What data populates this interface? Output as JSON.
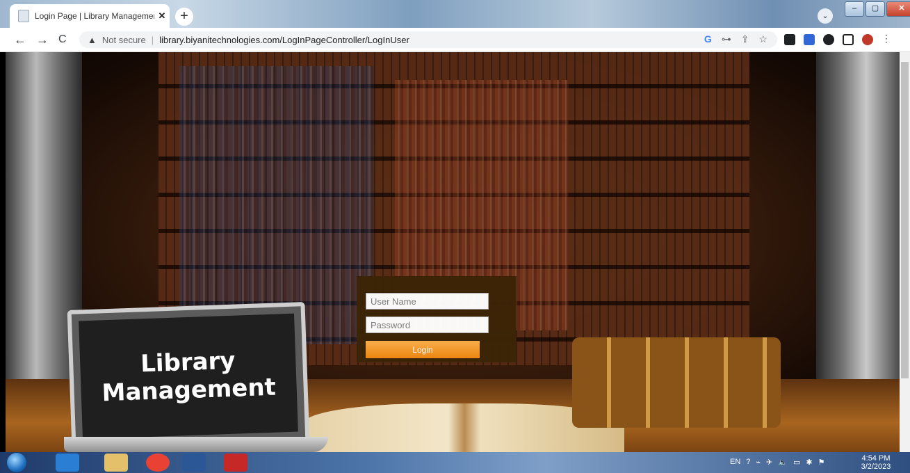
{
  "browser": {
    "tab_title": "Login Page | Library Managemen",
    "tab_close": "✕",
    "new_tab": "+",
    "tab_dropdown": "⌄",
    "window_controls": [
      "–",
      "▢",
      "✕"
    ],
    "nav": {
      "back": "←",
      "forward": "→",
      "reload": "C"
    },
    "security_warning": "▲",
    "not_secure": "Not secure",
    "separator": "|",
    "url": "library.biyanitechnologies.com/LogInPageController/LogInUser",
    "omnibox_icons": [
      "G",
      "⊶",
      "⇪",
      "☆"
    ],
    "extension_colors": [
      "#202124",
      "#3367d6",
      "#202124",
      "#202124",
      "#c0392b"
    ],
    "menu": "⋮"
  },
  "page": {
    "laptop_line1": "Library",
    "laptop_line2": "Management",
    "login": {
      "username_placeholder": "User Name",
      "password_placeholder": "Password",
      "login_label": "Login"
    }
  },
  "taskbar": {
    "apps": [
      "ie-icon",
      "folder-icon",
      "chrome-icon",
      "word-icon",
      "acrobat-icon"
    ],
    "app_colors": [
      "#2a7fd4",
      "#e5c06a",
      "#e94235",
      "#2b5797",
      "#c62828"
    ],
    "language": "EN",
    "tray_icons": [
      "?",
      "⌁",
      "✈",
      "🔈",
      "▭",
      "✱",
      "⚑"
    ],
    "time": "4:54 PM",
    "date": "3/2/2023"
  }
}
